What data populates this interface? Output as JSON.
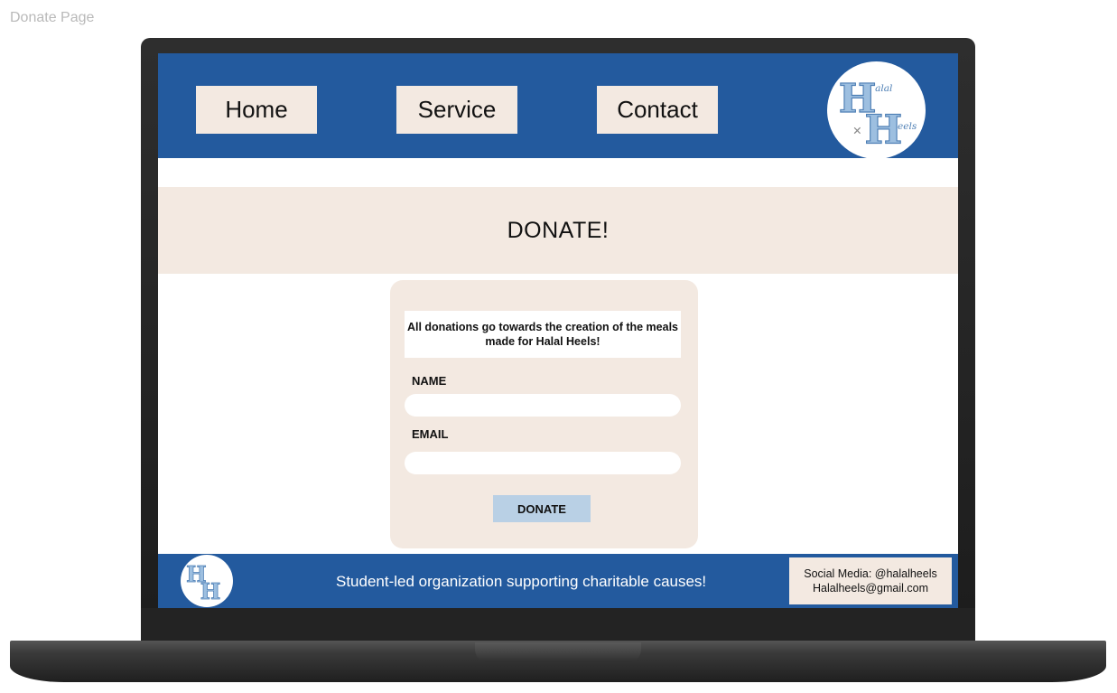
{
  "frame_label": "Donate Page",
  "header": {
    "nav": [
      {
        "label": "Home"
      },
      {
        "label": "Service"
      },
      {
        "label": "Contact"
      }
    ],
    "logo_text": "Halal Heels"
  },
  "banner": {
    "title": "DONATE!"
  },
  "donate_card": {
    "note": "All donations go towards the creation of the meals made for Halal Heels!",
    "name_label": "NAME",
    "email_label": "EMAIL",
    "name_value": "",
    "email_value": "",
    "button_label": "DONATE"
  },
  "footer": {
    "tagline": "Student-led organization supporting charitable causes!",
    "social": "Social Media: @halalheels",
    "email": "Halalheels@gmail.com"
  },
  "colors": {
    "brand_blue": "#235a9e",
    "cream": "#f3e9e1",
    "button_blue": "#b9d0e5",
    "logo_blue": "#9dbfe0"
  }
}
